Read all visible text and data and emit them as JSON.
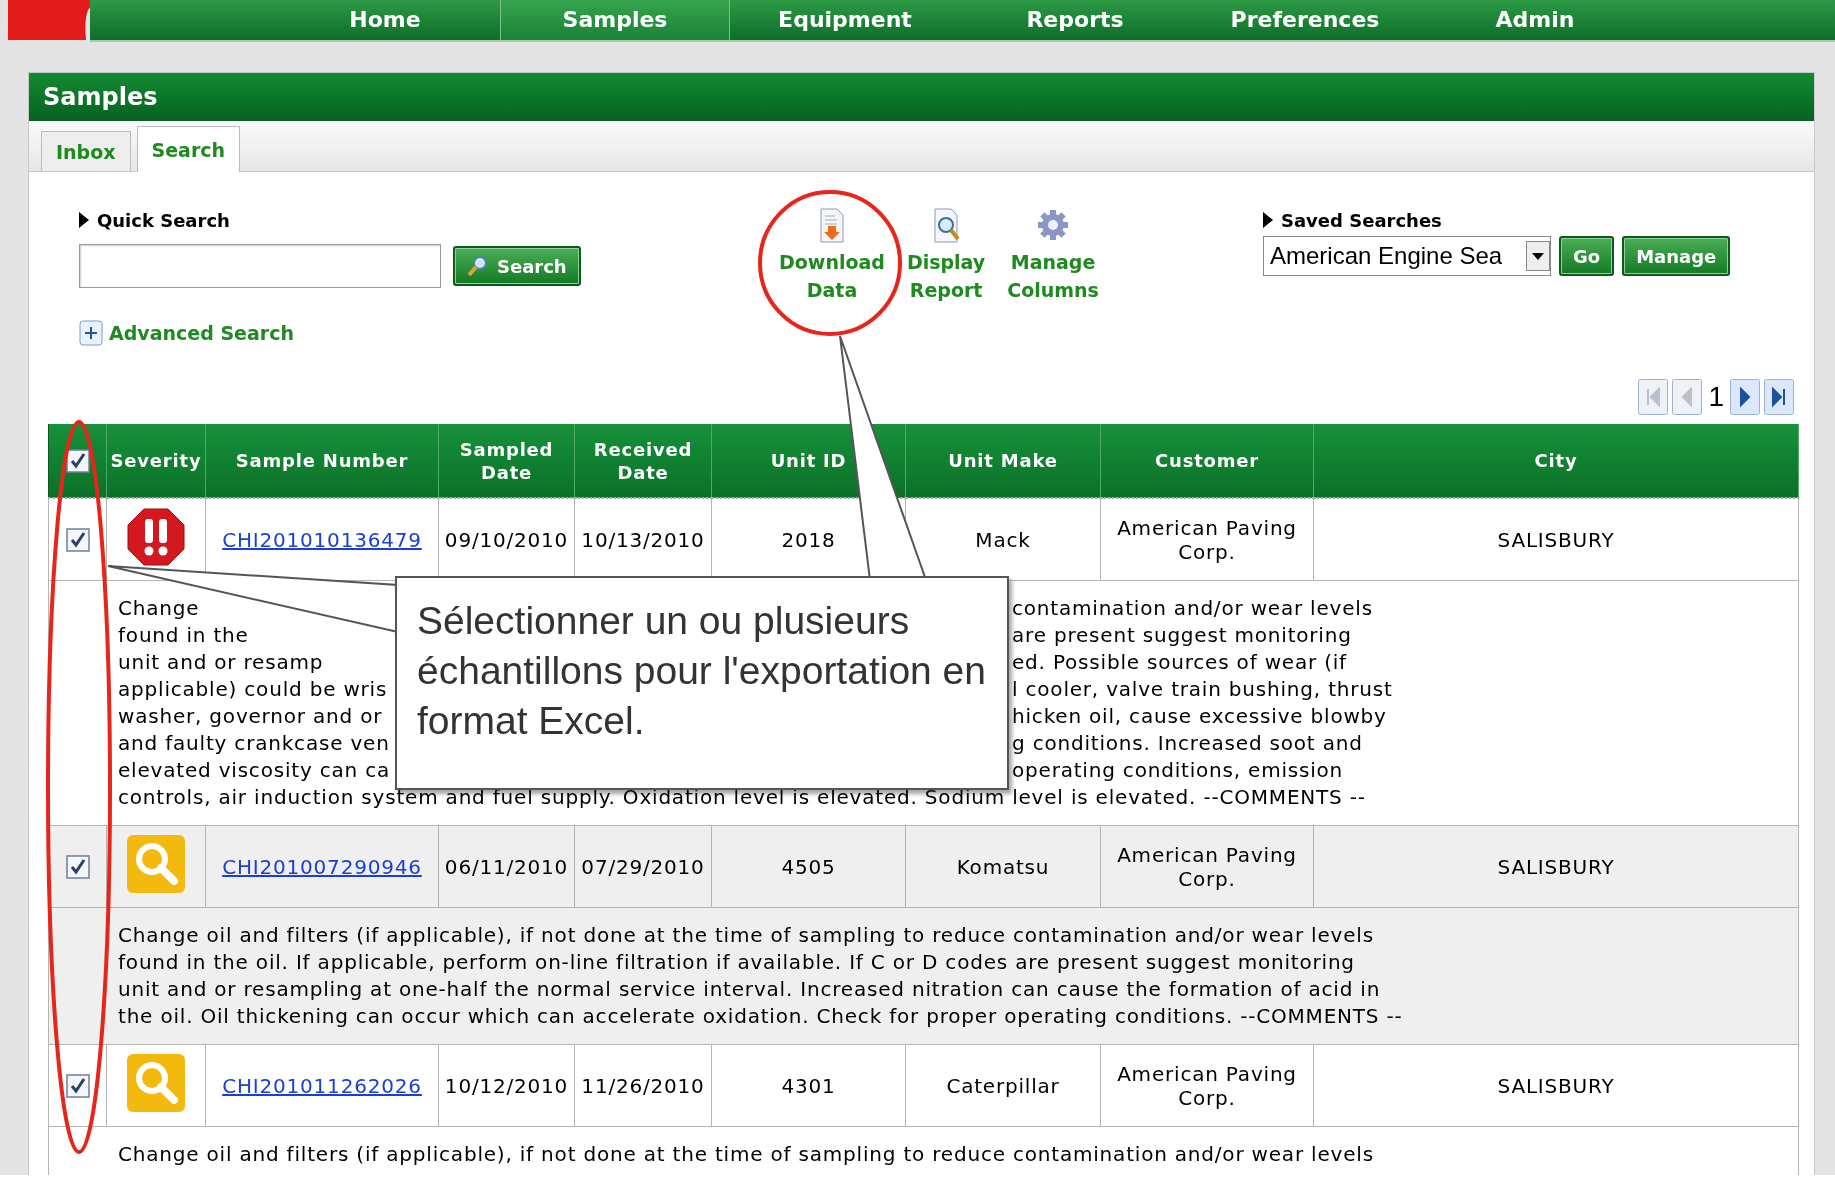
{
  "nav": [
    {
      "label": "Home",
      "selected": false
    },
    {
      "label": "Samples",
      "selected": true
    },
    {
      "label": "Equipment",
      "selected": false
    },
    {
      "label": "Reports",
      "selected": false
    },
    {
      "label": "Preferences",
      "selected": false
    },
    {
      "label": "Admin",
      "selected": false
    }
  ],
  "panel": {
    "title": "Samples"
  },
  "tabs": [
    {
      "label": "Inbox",
      "selected": false
    },
    {
      "label": "Search",
      "selected": true
    }
  ],
  "quick_search": {
    "label": "Quick Search",
    "button": "Search"
  },
  "advanced_search": {
    "label": "Advanced Search"
  },
  "toolbar": [
    {
      "kind": "download",
      "label": "Download Data"
    },
    {
      "kind": "report",
      "label": "Display Report"
    },
    {
      "kind": "columns",
      "label": "Manage Columns"
    }
  ],
  "saved_searches": {
    "label": "Saved Searches",
    "value": "American Engine Sea",
    "buttons": [
      "Go",
      "Manage"
    ]
  },
  "pager": {
    "page": "1",
    "buttons": [
      {
        "kind": "first",
        "disabled": true
      },
      {
        "kind": "prev",
        "disabled": true
      },
      {
        "kind": "next",
        "disabled": false
      },
      {
        "kind": "last",
        "disabled": false
      }
    ]
  },
  "table": {
    "select_all_checked": true,
    "columns": [
      "Severity",
      "Sample Number",
      "Sampled Date",
      "Received Date",
      "Unit ID",
      "Unit Make",
      "Customer",
      "City"
    ],
    "rows": [
      {
        "checked": true,
        "kind": "critical",
        "sample_number": "CHI201010136479",
        "sampled_date": "09/10/2010",
        "received_date": "10/13/2010",
        "unit_id": "2018",
        "unit_make": "Mack",
        "customer": "American Paving Corp.",
        "city": "SALISBURY",
        "comment_lines": [
          {
            "left": "Change",
            "right": "contamination and/or wear levels"
          },
          {
            "left": "found in the",
            "right": "are present suggest monitoring"
          },
          {
            "left": "unit and or resamp",
            "right": "ed. Possible sources of wear (if"
          },
          {
            "left": "applicable) could be wris",
            "right": "l cooler, valve train bushing, thrust"
          },
          {
            "left": "washer, governor and or",
            "right": "hicken oil, cause excessive blowby"
          },
          {
            "left": "and faulty crankcase ven",
            "right": "g conditions. Increased soot and"
          },
          {
            "left": "elevated viscosity can ca",
            "right": "operating conditions, emission"
          },
          {
            "left": "controls, air induction system and fuel supply. Oxidation level is elevated. Sodium level is elevated. --COMMENTS --"
          }
        ]
      },
      {
        "checked": true,
        "kind": "caution",
        "sample_number": "CHI201007290946",
        "sampled_date": "06/11/2010",
        "received_date": "07/29/2010",
        "unit_id": "4505",
        "unit_make": "Komatsu",
        "customer": "American Paving Corp.",
        "city": "SALISBURY",
        "comment_lines": [
          {
            "left": "Change oil and filters (if applicable), if not done at the time of sampling to reduce contamination and/or wear levels"
          },
          {
            "left": "found in the oil. If applicable, perform on-line filtration if available. If C or D codes are present suggest monitoring"
          },
          {
            "left": "unit and or resampling at one-half the normal service interval. Increased nitration can cause the formation of acid in"
          },
          {
            "left": "the oil. Oil thickening can occur which can accelerate oxidation. Check for proper operating conditions. --COMMENTS --"
          }
        ]
      },
      {
        "checked": true,
        "kind": "caution",
        "sample_number": "CHI201011262026",
        "sampled_date": "10/12/2010",
        "received_date": "11/26/2010",
        "unit_id": "4301",
        "unit_make": "Caterpillar",
        "customer": "American Paving Corp.",
        "city": "SALISBURY",
        "comment_lines": [
          {
            "left": "Change oil and filters (if applicable), if not done at the time of sampling to reduce contamination and/or wear levels"
          }
        ]
      }
    ]
  },
  "annotation": {
    "callout": "Sélectionner un ou plusieurs échantillons pour l'exportation en format Excel."
  }
}
